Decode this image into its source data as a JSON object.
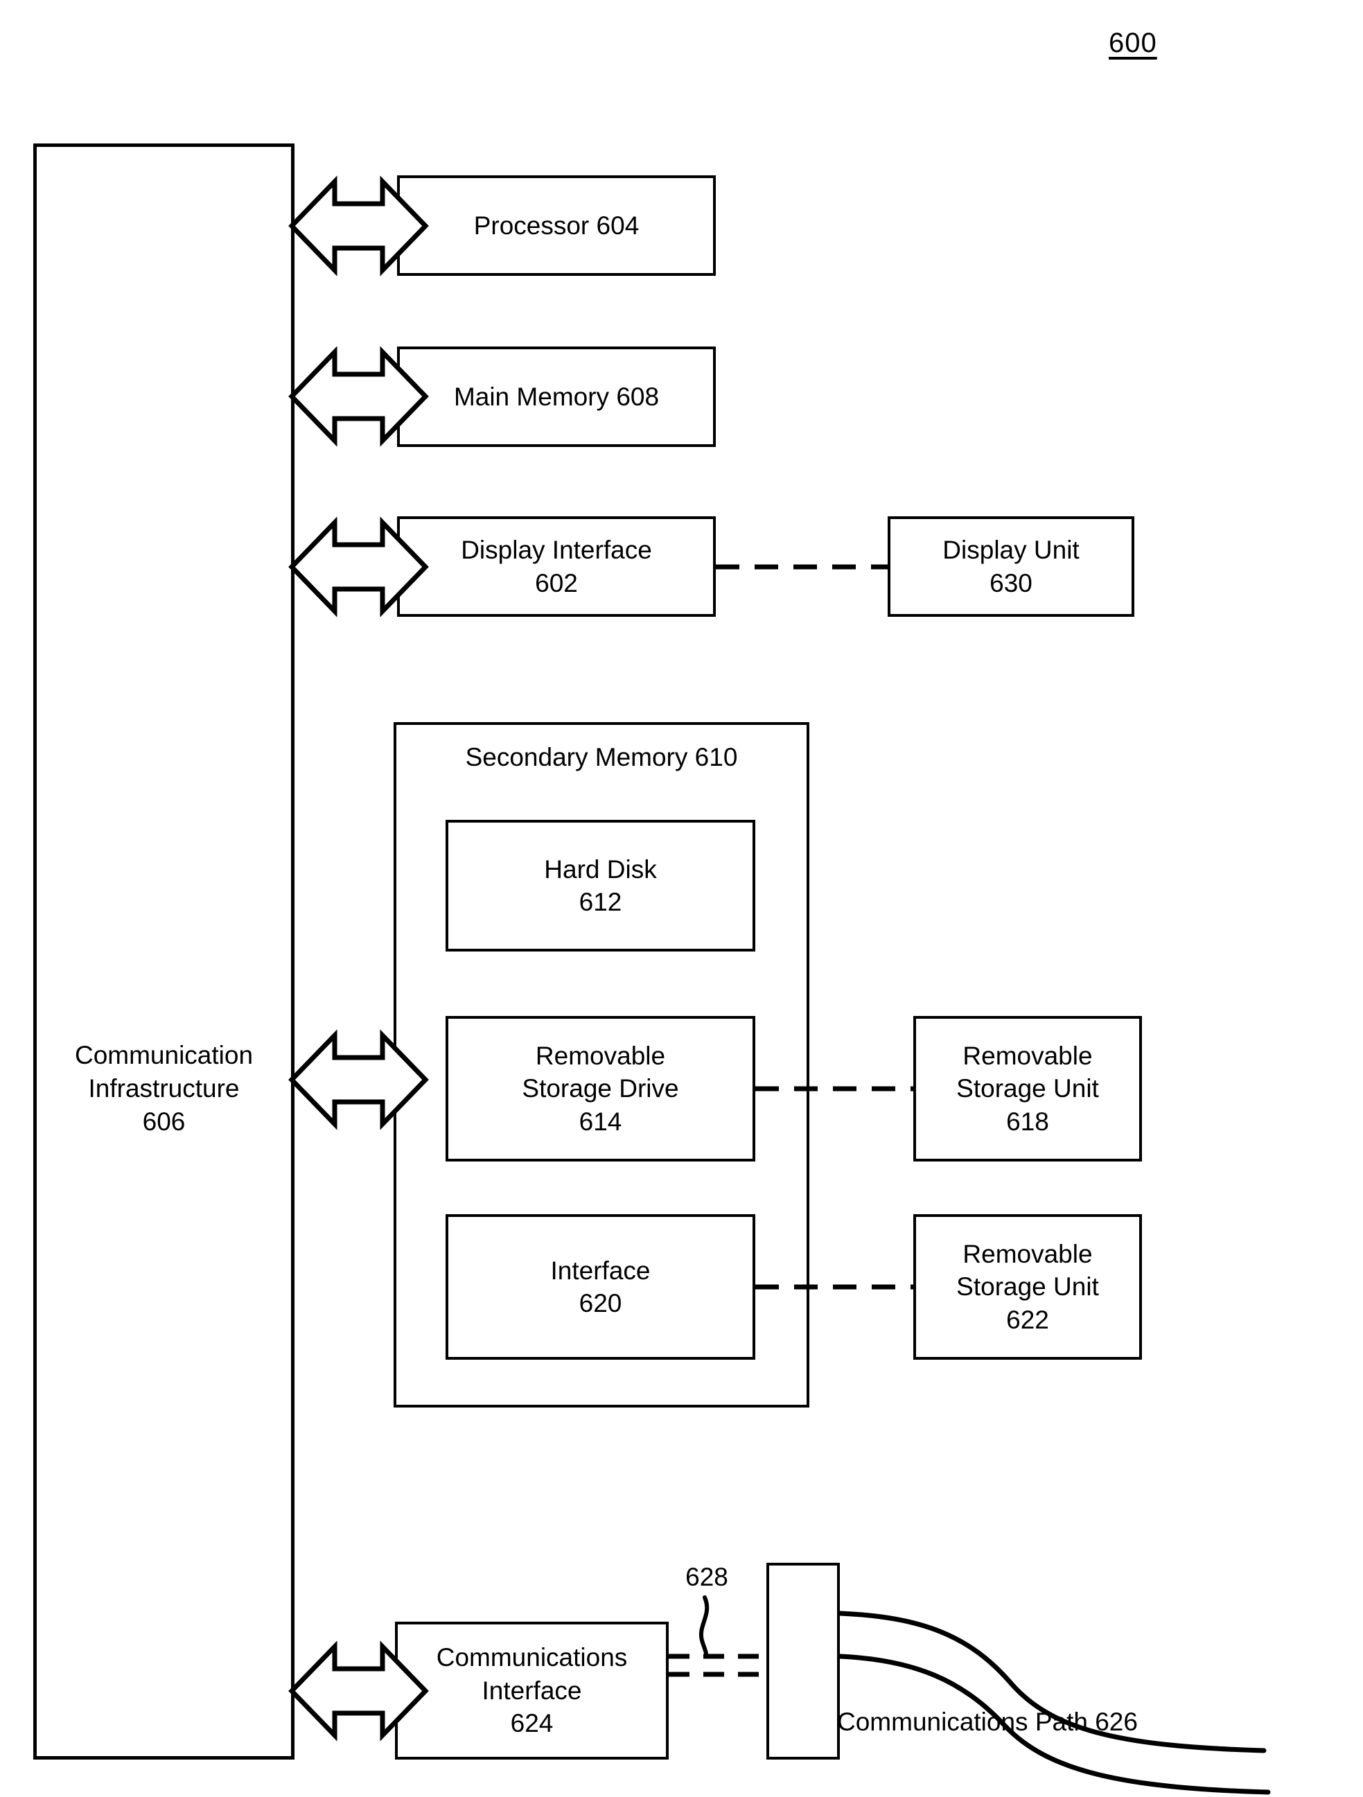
{
  "figure": {
    "number": "600"
  },
  "bus": {
    "label_line1": "Communication",
    "label_line2": "Infrastructure",
    "label_line3": "606"
  },
  "blocks": {
    "processor": {
      "line1": "Processor 604"
    },
    "main_memory": {
      "line1": "Main Memory 608"
    },
    "display_interface": {
      "line1": "Display Interface",
      "line2": "602"
    },
    "display_unit": {
      "line1": "Display Unit",
      "line2": "630"
    },
    "secondary_memory": {
      "title": "Secondary Memory 610"
    },
    "hard_disk": {
      "line1": "Hard Disk",
      "line2": "612"
    },
    "removable_storage_drive": {
      "line1": "Removable",
      "line2": "Storage Drive",
      "line3": "614"
    },
    "removable_storage_unit_618": {
      "line1": "Removable",
      "line2": "Storage Unit",
      "line3": "618"
    },
    "interface_620": {
      "line1": "Interface",
      "line2": "620"
    },
    "removable_storage_unit_622": {
      "line1": "Removable",
      "line2": "Storage Unit",
      "line3": "622"
    },
    "communications_interface": {
      "line1": "Communications",
      "line2": "Interface",
      "line3": "624"
    },
    "connector": {
      "label": ""
    }
  },
  "annotations": {
    "lead_628": "628",
    "communications_path": "Communications Path 626"
  },
  "colors": {
    "stroke": "#000000",
    "background": "#ffffff"
  }
}
